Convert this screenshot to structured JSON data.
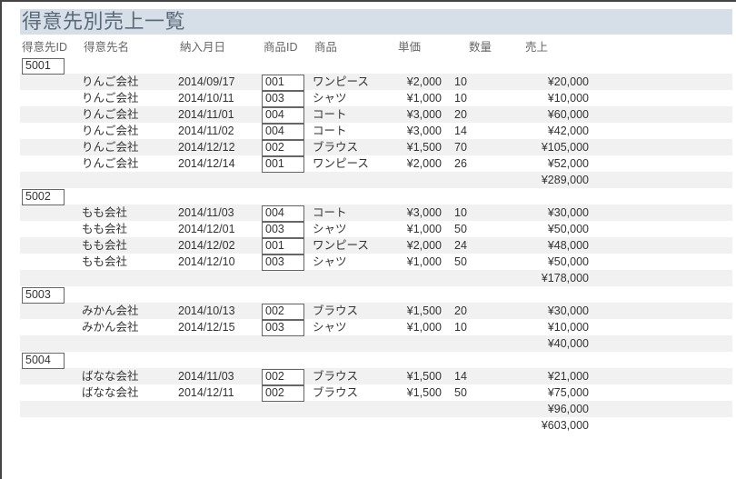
{
  "title": "得意先別売上一覧",
  "columns": {
    "id": "得意先ID",
    "name": "得意先名",
    "date": "納入月日",
    "pid": "商品ID",
    "prod": "商品",
    "unit": "単価",
    "qty": "数量",
    "amt": "売上"
  },
  "rows": [
    {
      "type": "head",
      "shaded": false,
      "id": "5001"
    },
    {
      "type": "data",
      "shaded": true,
      "name": "りんご会社",
      "date": "2014/09/17",
      "pid": "001",
      "prod": "ワンピース",
      "unit": "¥2,000",
      "qty": "10",
      "amt": "¥20,000"
    },
    {
      "type": "data",
      "shaded": false,
      "name": "りんご会社",
      "date": "2014/10/11",
      "pid": "003",
      "prod": "シャツ",
      "unit": "¥1,000",
      "qty": "10",
      "amt": "¥10,000"
    },
    {
      "type": "data",
      "shaded": true,
      "name": "りんご会社",
      "date": "2014/11/01",
      "pid": "004",
      "prod": "コート",
      "unit": "¥3,000",
      "qty": "20",
      "amt": "¥60,000"
    },
    {
      "type": "data",
      "shaded": false,
      "name": "りんご会社",
      "date": "2014/11/02",
      "pid": "004",
      "prod": "コート",
      "unit": "¥3,000",
      "qty": "14",
      "amt": "¥42,000"
    },
    {
      "type": "data",
      "shaded": true,
      "name": "りんご会社",
      "date": "2014/12/12",
      "pid": "002",
      "prod": "ブラウス",
      "unit": "¥1,500",
      "qty": "70",
      "amt": "¥105,000"
    },
    {
      "type": "data",
      "shaded": false,
      "name": "りんご会社",
      "date": "2014/12/14",
      "pid": "001",
      "prod": "ワンピース",
      "unit": "¥2,000",
      "qty": "26",
      "amt": "¥52,000"
    },
    {
      "type": "sub",
      "shaded": true,
      "amt": "¥289,000"
    },
    {
      "type": "head",
      "shaded": false,
      "id": "5002"
    },
    {
      "type": "data",
      "shaded": true,
      "name": "もも会社",
      "date": "2014/11/03",
      "pid": "004",
      "prod": "コート",
      "unit": "¥3,000",
      "qty": "10",
      "amt": "¥30,000"
    },
    {
      "type": "data",
      "shaded": false,
      "name": "もも会社",
      "date": "2014/12/01",
      "pid": "003",
      "prod": "シャツ",
      "unit": "¥1,000",
      "qty": "50",
      "amt": "¥50,000"
    },
    {
      "type": "data",
      "shaded": true,
      "name": "もも会社",
      "date": "2014/12/02",
      "pid": "001",
      "prod": "ワンピース",
      "unit": "¥2,000",
      "qty": "24",
      "amt": "¥48,000"
    },
    {
      "type": "data",
      "shaded": false,
      "name": "もも会社",
      "date": "2014/12/10",
      "pid": "003",
      "prod": "シャツ",
      "unit": "¥1,000",
      "qty": "50",
      "amt": "¥50,000"
    },
    {
      "type": "sub",
      "shaded": true,
      "amt": "¥178,000"
    },
    {
      "type": "head",
      "shaded": false,
      "id": "5003"
    },
    {
      "type": "data",
      "shaded": true,
      "name": "みかん会社",
      "date": "2014/10/13",
      "pid": "002",
      "prod": "ブラウス",
      "unit": "¥1,500",
      "qty": "20",
      "amt": "¥30,000"
    },
    {
      "type": "data",
      "shaded": false,
      "name": "みかん会社",
      "date": "2014/12/15",
      "pid": "003",
      "prod": "シャツ",
      "unit": "¥1,000",
      "qty": "10",
      "amt": "¥10,000"
    },
    {
      "type": "sub",
      "shaded": true,
      "amt": "¥40,000"
    },
    {
      "type": "head",
      "shaded": false,
      "id": "5004"
    },
    {
      "type": "data",
      "shaded": true,
      "name": "ばなな会社",
      "date": "2014/11/03",
      "pid": "002",
      "prod": "ブラウス",
      "unit": "¥1,500",
      "qty": "14",
      "amt": "¥21,000"
    },
    {
      "type": "data",
      "shaded": false,
      "name": "ばなな会社",
      "date": "2014/12/11",
      "pid": "002",
      "prod": "ブラウス",
      "unit": "¥1,500",
      "qty": "50",
      "amt": "¥75,000"
    },
    {
      "type": "sub",
      "shaded": true,
      "amt": "¥96,000"
    },
    {
      "type": "total",
      "shaded": false,
      "amt": "¥603,000"
    }
  ]
}
